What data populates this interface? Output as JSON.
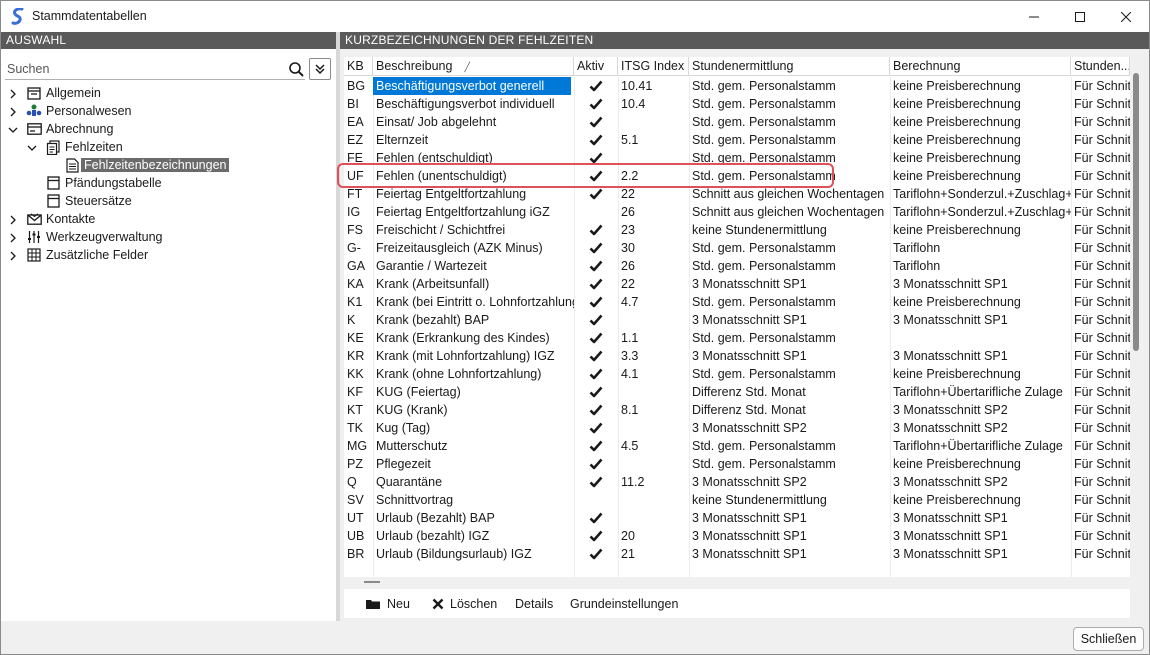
{
  "window": {
    "title": "Stammdatentabellen"
  },
  "left_panel": {
    "header": "AUSWAHL",
    "search_placeholder": "Suchen"
  },
  "tree": [
    {
      "label": "Allgemein",
      "icon": "folder-icon",
      "level": 0,
      "expanded": false
    },
    {
      "label": "Personalwesen",
      "icon": "people-icon",
      "level": 0,
      "expanded": false
    },
    {
      "label": "Abrechnung",
      "icon": "card-icon",
      "level": 0,
      "expanded": true
    },
    {
      "label": "Fehlzeiten",
      "icon": "document-stack-icon",
      "level": 1,
      "expanded": true
    },
    {
      "label": "Fehlzeitenbezeichnungen",
      "icon": "document-icon",
      "level": 2,
      "selected": true
    },
    {
      "label": "Pfändungstabelle",
      "icon": "table-icon",
      "level": 1
    },
    {
      "label": "Steuersätze",
      "icon": "table-icon",
      "level": 1
    },
    {
      "label": "Kontakte",
      "icon": "envelope-icon",
      "level": 0,
      "expanded": false
    },
    {
      "label": "Werkzeugverwaltung",
      "icon": "sliders-icon",
      "level": 0,
      "expanded": false
    },
    {
      "label": "Zusätzliche Felder",
      "icon": "grid-icon",
      "level": 0,
      "expanded": false
    }
  ],
  "right_panel": {
    "header": "KURZBEZEICHNUNGEN DER FEHLZEITEN"
  },
  "grid": {
    "columns": [
      "KB",
      "Beschreibung",
      "Aktiv",
      "ITSG Index",
      "Stundenermittlung",
      "Berechnung",
      "Stunden..."
    ],
    "rows": [
      {
        "kb": "BG",
        "beschreibung": "Beschäftigungsverbot generell",
        "aktiv": true,
        "itsg": "10.41",
        "stunden": "Std. gem. Personalstamm",
        "berechnung": "keine Preisberechnung",
        "stunden2": "Für Schnitt"
      },
      {
        "kb": "BI",
        "beschreibung": "Beschäftigungsverbot individuell",
        "aktiv": true,
        "itsg": "10.4",
        "stunden": "Std. gem. Personalstamm",
        "berechnung": "keine Preisberechnung",
        "stunden2": "Für Schnitt"
      },
      {
        "kb": "EA",
        "beschreibung": "Einsat/ Job abgelehnt",
        "aktiv": true,
        "itsg": "",
        "stunden": "Std. gem. Personalstamm",
        "berechnung": "keine Preisberechnung",
        "stunden2": "Für Schnitt"
      },
      {
        "kb": "EZ",
        "beschreibung": "Elternzeit",
        "aktiv": true,
        "itsg": "5.1",
        "stunden": "Std. gem. Personalstamm",
        "berechnung": "keine Preisberechnung",
        "stunden2": "Für Schnitt"
      },
      {
        "kb": "FE",
        "beschreibung": "Fehlen (entschuldigt)",
        "aktiv": true,
        "itsg": "",
        "stunden": "Std. gem. Personalstamm",
        "berechnung": "keine Preisberechnung",
        "stunden2": "Für Schnitt"
      },
      {
        "kb": "UF",
        "beschreibung": "Fehlen (unentschuldigt)",
        "aktiv": true,
        "itsg": "2.2",
        "stunden": "Std. gem. Personalstamm",
        "berechnung": "keine Preisberechnung",
        "stunden2": "Für Schnitt"
      },
      {
        "kb": "FT",
        "beschreibung": "Feiertag Entgeltfortzahlung",
        "aktiv": true,
        "itsg": "22",
        "stunden": "Schnitt aus gleichen Wochentagen",
        "berechnung": "Tariflohn+Sonderzul.+Zuschlag+Ü",
        "stunden2": "Für Schnitt"
      },
      {
        "kb": "IG",
        "beschreibung": "Feiertag Entgeltfortzahlung iGZ",
        "aktiv": false,
        "itsg": "26",
        "stunden": "Schnitt aus gleichen Wochentagen",
        "berechnung": "Tariflohn+Sonderzul.+Zuschlag+Ü",
        "stunden2": "Für Schnitt"
      },
      {
        "kb": "FS",
        "beschreibung": "Freischicht / Schichtfrei",
        "aktiv": true,
        "itsg": "23",
        "stunden": "keine Stundenermittlung",
        "berechnung": "keine Preisberechnung",
        "stunden2": "Für Schnitt"
      },
      {
        "kb": "G-",
        "beschreibung": "Freizeitausgleich (AZK Minus)",
        "aktiv": true,
        "itsg": "30",
        "stunden": "Std. gem. Personalstamm",
        "berechnung": "Tariflohn",
        "stunden2": "Für Schnitt"
      },
      {
        "kb": "GA",
        "beschreibung": "Garantie / Wartezeit",
        "aktiv": true,
        "itsg": "26",
        "stunden": "Std. gem. Personalstamm",
        "berechnung": "Tariflohn",
        "stunden2": "Für Schnitt"
      },
      {
        "kb": "KA",
        "beschreibung": "Krank (Arbeitsunfall)",
        "aktiv": true,
        "itsg": "22",
        "stunden": "3 Monatsschnitt SP1",
        "berechnung": "3 Monatsschnitt SP1",
        "stunden2": "Für Schnitt"
      },
      {
        "kb": "K1",
        "beschreibung": "Krank (bei Eintritt o. Lohnfortzahlung)",
        "aktiv": true,
        "itsg": "4.7",
        "stunden": "Std. gem. Personalstamm",
        "berechnung": "keine Preisberechnung",
        "stunden2": "Für Schnitt"
      },
      {
        "kb": "K",
        "beschreibung": "Krank (bezahlt) BAP",
        "aktiv": true,
        "itsg": "",
        "stunden": "3 Monatsschnitt SP1",
        "berechnung": "3 Monatsschnitt SP1",
        "stunden2": "Für Schnitt"
      },
      {
        "kb": "KE",
        "beschreibung": "Krank (Erkrankung des Kindes)",
        "aktiv": true,
        "itsg": "1.1",
        "stunden": "Std. gem. Personalstamm",
        "berechnung": "",
        "stunden2": "Für Schnitt"
      },
      {
        "kb": "KR",
        "beschreibung": "Krank (mit Lohnfortzahlung) IGZ",
        "aktiv": true,
        "itsg": "3.3",
        "stunden": "3 Monatsschnitt SP1",
        "berechnung": "3 Monatsschnitt SP1",
        "stunden2": "Für Schnitt"
      },
      {
        "kb": "KK",
        "beschreibung": "Krank (ohne Lohnfortzahlung)",
        "aktiv": true,
        "itsg": "4.1",
        "stunden": "Std. gem. Personalstamm",
        "berechnung": "keine Preisberechnung",
        "stunden2": "Für Schnitt"
      },
      {
        "kb": "KF",
        "beschreibung": "KUG (Feiertag)",
        "aktiv": true,
        "itsg": "",
        "stunden": "Differenz Std. Monat",
        "berechnung": "Tariflohn+Übertarifliche Zulage",
        "stunden2": "Für Schnitt"
      },
      {
        "kb": "KT",
        "beschreibung": "KUG (Krank)",
        "aktiv": true,
        "itsg": "8.1",
        "stunden": "Differenz Std. Monat",
        "berechnung": "3 Monatsschnitt SP2",
        "stunden2": "Für Schnitt"
      },
      {
        "kb": "TK",
        "beschreibung": "Kug (Tag)",
        "aktiv": true,
        "itsg": "",
        "stunden": "3 Monatsschnitt SP2",
        "berechnung": "3 Monatsschnitt SP2",
        "stunden2": "Für Schnitt"
      },
      {
        "kb": "MG",
        "beschreibung": "Mutterschutz",
        "aktiv": true,
        "itsg": "4.5",
        "stunden": "Std. gem. Personalstamm",
        "berechnung": "Tariflohn+Übertarifliche Zulage",
        "stunden2": "Für Schnitt"
      },
      {
        "kb": "PZ",
        "beschreibung": "Pflegezeit",
        "aktiv": true,
        "itsg": "",
        "stunden": "Std. gem. Personalstamm",
        "berechnung": "keine Preisberechnung",
        "stunden2": "Für Schnitt"
      },
      {
        "kb": "Q",
        "beschreibung": "Quarantäne",
        "aktiv": true,
        "itsg": "11.2",
        "stunden": "3 Monatsschnitt SP2",
        "berechnung": "3 Monatsschnitt SP2",
        "stunden2": "Für Schnitt"
      },
      {
        "kb": "SV",
        "beschreibung": "Schnittvortrag",
        "aktiv": false,
        "itsg": "",
        "stunden": "keine Stundenermittlung",
        "berechnung": "keine Preisberechnung",
        "stunden2": "Für Schnitt"
      },
      {
        "kb": "UT",
        "beschreibung": "Urlaub (Bezahlt) BAP",
        "aktiv": true,
        "itsg": "",
        "stunden": "3 Monatsschnitt SP1",
        "berechnung": "3 Monatsschnitt SP1",
        "stunden2": "Für Schnitt"
      },
      {
        "kb": "UB",
        "beschreibung": "Urlaub (bezahlt) IGZ",
        "aktiv": true,
        "itsg": "20",
        "stunden": "3 Monatsschnitt SP1",
        "berechnung": "3 Monatsschnitt SP1",
        "stunden2": "Für Schnitt"
      },
      {
        "kb": "BR",
        "beschreibung": "Urlaub (Bildungsurlaub) IGZ",
        "aktiv": true,
        "itsg": "21",
        "stunden": "3 Monatsschnitt SP1",
        "berechnung": "3 Monatsschnitt SP1",
        "stunden2": "Für Schnitt"
      }
    ],
    "selected_row": 0,
    "highlighted_row": 5
  },
  "actions": {
    "new": "Neu",
    "delete": "Löschen",
    "details": "Details",
    "settings": "Grundeinstellungen"
  },
  "footer": {
    "close": "Schließen"
  },
  "colors": {
    "selection": "#0078d7",
    "header_bg": "#5a5a5a",
    "highlight_border": "#e0505a",
    "tree_selected": "#6b6b6b"
  }
}
